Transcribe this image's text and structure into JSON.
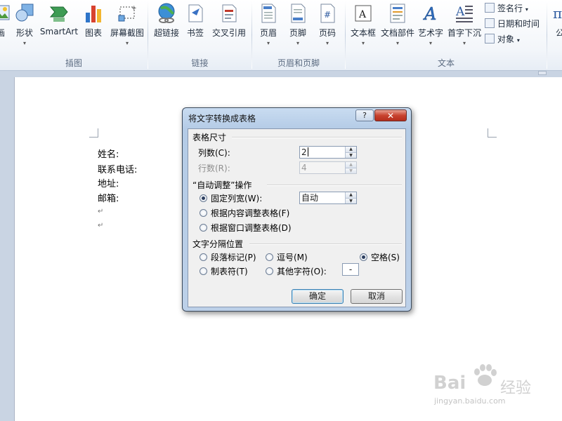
{
  "ribbon": {
    "tools": [
      {
        "id": "picture",
        "label": "画",
        "icon": "picture-icon",
        "arrow": ""
      },
      {
        "id": "shape",
        "label": "形状",
        "icon": "shape-icon",
        "arrow": "▾"
      },
      {
        "id": "smartart",
        "label": "SmartArt",
        "icon": "smartart-icon",
        "arrow": ""
      },
      {
        "id": "chart",
        "label": "图表",
        "icon": "chart-icon",
        "arrow": ""
      },
      {
        "id": "screenshot",
        "label": "屏幕截图",
        "icon": "screenshot-icon",
        "arrow": "▾"
      },
      {
        "id": "hyperlink",
        "label": "超链接",
        "icon": "hyperlink-icon",
        "arrow": ""
      },
      {
        "id": "bookmark",
        "label": "书签",
        "icon": "bookmark-icon",
        "arrow": ""
      },
      {
        "id": "crossref",
        "label": "交叉引用",
        "icon": "cross-reference-icon",
        "arrow": ""
      },
      {
        "id": "header",
        "label": "页眉",
        "icon": "header-icon",
        "arrow": "▾"
      },
      {
        "id": "footer",
        "label": "页脚",
        "icon": "footer-icon",
        "arrow": "▾"
      },
      {
        "id": "pagenum",
        "label": "页码",
        "icon": "page-number-icon",
        "arrow": "▾"
      },
      {
        "id": "textbox",
        "label": "文本框",
        "icon": "textbox-icon",
        "arrow": "▾"
      },
      {
        "id": "docparts",
        "label": "文档部件",
        "icon": "document-parts-icon",
        "arrow": "▾"
      },
      {
        "id": "wordart",
        "label": "艺术字",
        "icon": "wordart-icon",
        "arrow": "▾"
      },
      {
        "id": "dropcap",
        "label": "首字下沉",
        "icon": "dropcap-icon",
        "arrow": "▾"
      }
    ],
    "small_tools": [
      {
        "label": "签名行",
        "arrow": "▾",
        "icon": "signature-line-icon"
      },
      {
        "label": "日期和时间",
        "arrow": "",
        "icon": "date-time-icon"
      },
      {
        "label": "对象",
        "arrow": "▾",
        "icon": "object-icon"
      }
    ],
    "edge_label": "公",
    "groups": {
      "illustrations": "插图",
      "links": "链接",
      "header_footer": "页眉和页脚",
      "text": "文本"
    }
  },
  "document": {
    "lines": [
      "姓名:",
      "联系电话:",
      "地址:",
      "邮箱:"
    ],
    "para_mark": "↵"
  },
  "dialog": {
    "title": "将文字转换成表格",
    "help": "?",
    "close": "✕",
    "table_size": "表格尺寸",
    "columns_label": "列数(C):",
    "columns_value": "2",
    "rows_label": "行数(R):",
    "rows_value": "4",
    "autofit": "“自动调整”操作",
    "fixed_width_label": "固定列宽(W):",
    "fixed_width_value": "自动",
    "fit_content": "根据内容调整表格(F)",
    "fit_window": "根据窗口调整表格(D)",
    "separator": "文字分隔位置",
    "sep_paragraph": "段落标记(P)",
    "sep_comma": "逗号(M)",
    "sep_space": "空格(S)",
    "sep_tab": "制表符(T)",
    "sep_other": "其他字符(O):",
    "sep_other_value": "-",
    "ok": "确定",
    "cancel": "取消"
  },
  "watermark": {
    "brand": "Bai",
    "brand_cn": "经验",
    "url": "jingyan.baidu.com"
  }
}
